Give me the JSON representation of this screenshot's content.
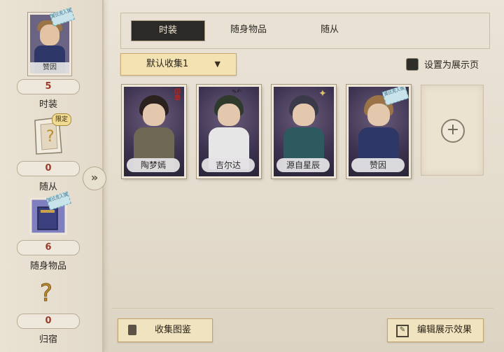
{
  "sidebar": {
    "profile_name": "赞因",
    "profile_stamp": "奥比克人偶",
    "stats": [
      {
        "value": "5",
        "label": "时装"
      },
      {
        "value": "0",
        "label": "随从"
      },
      {
        "value": "6",
        "label": "随身物品"
      },
      {
        "value": "0",
        "label": "归宿"
      }
    ],
    "limited_tag": "限定",
    "item_stamp": "奥比克人偶"
  },
  "tabs": [
    {
      "label": "时装",
      "active": true
    },
    {
      "label": "随身物品",
      "active": false
    },
    {
      "label": "随从",
      "active": false
    }
  ],
  "collection_dropdown": {
    "value": "默认收集1"
  },
  "showcase_checkbox": {
    "label": "设置为展示页",
    "checked": false
  },
  "cards": [
    {
      "name": "陶梦嫣",
      "hair": "#2b2220",
      "body": "#6f6855",
      "badge": "红印"
    },
    {
      "name": "吉尔达",
      "hair": "#2f3a2c",
      "body": "#e6e6e6",
      "badge": "签名"
    },
    {
      "name": "源自星辰",
      "hair": "#3a3a4a",
      "body": "#2d5a5f",
      "badge": "星章"
    },
    {
      "name": "赞因",
      "hair": "#9a7446",
      "body": "#2d3868",
      "badge": "奥比克人偶"
    }
  ],
  "footer": {
    "left_button": "收集图鉴",
    "right_button": "编辑展示效果"
  }
}
